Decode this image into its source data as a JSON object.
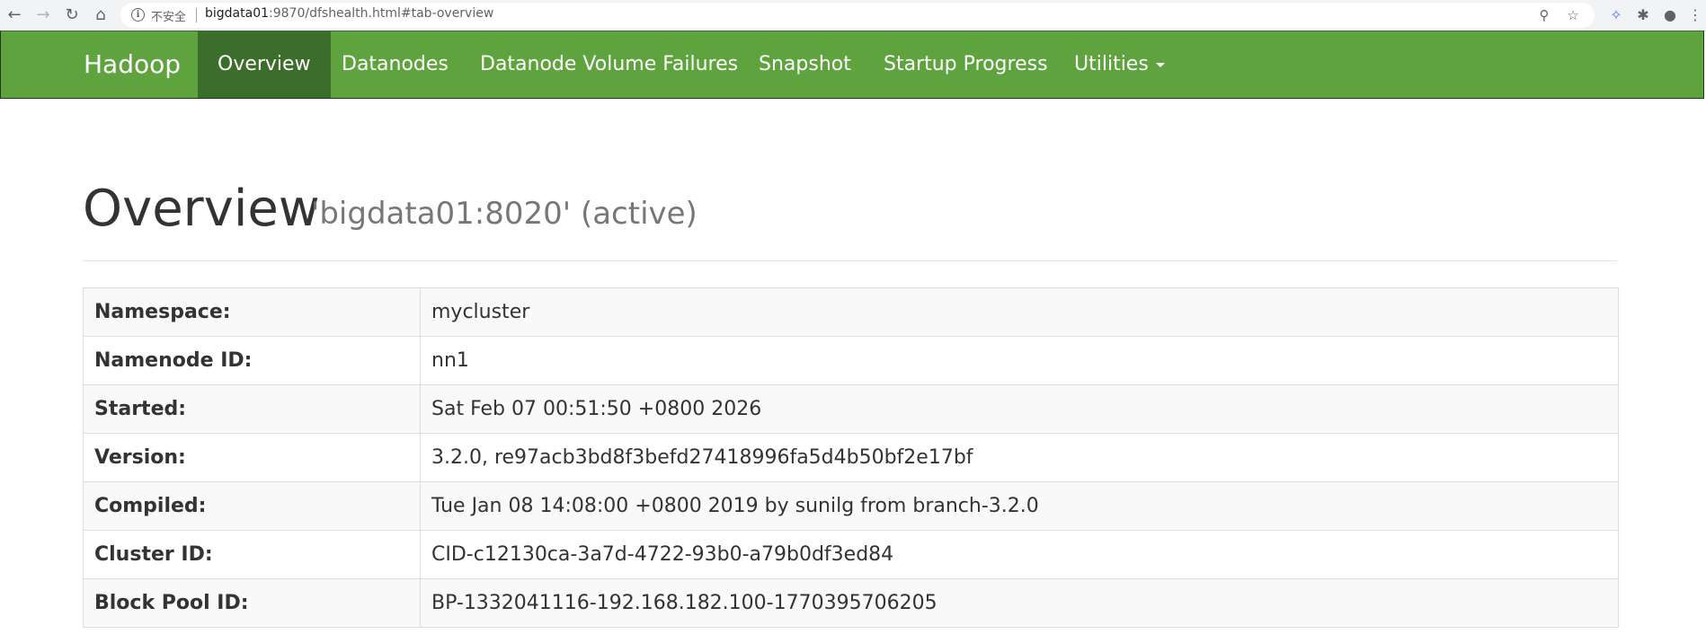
{
  "browser": {
    "security_label": "不安全",
    "url_host": "bigdata01",
    "url_rest": ":9870/dfshealth.html#tab-overview"
  },
  "navbar": {
    "brand": "Hadoop",
    "items": [
      {
        "label": "Overview",
        "active": true
      },
      {
        "label": "Datanodes",
        "active": false
      },
      {
        "label": "Datanode Volume Failures",
        "active": false
      },
      {
        "label": "Snapshot",
        "active": false
      },
      {
        "label": "Startup Progress",
        "active": false
      },
      {
        "label": "Utilities",
        "active": false,
        "dropdown": true
      }
    ],
    "colors": {
      "background": "#5fa33e",
      "active_background": "#3b6e2a"
    }
  },
  "header": {
    "title": "Overview",
    "subtitle": "'bigdata01:8020' (active)"
  },
  "overview_table": [
    {
      "key": "Namespace:",
      "value": "mycluster"
    },
    {
      "key": "Namenode ID:",
      "value": "nn1"
    },
    {
      "key": "Started:",
      "value": "Sat Feb 07 00:51:50 +0800 2026"
    },
    {
      "key": "Version:",
      "value": "3.2.0, re97acb3bd8f3befd27418996fa5d4b50bf2e17bf"
    },
    {
      "key": "Compiled:",
      "value": "Tue Jan 08 14:08:00 +0800 2019 by sunilg from branch-3.2.0"
    },
    {
      "key": "Cluster ID:",
      "value": "CID-c12130ca-3a7d-4722-93b0-a79b0df3ed84"
    },
    {
      "key": "Block Pool ID:",
      "value": "BP-1332041116-192.168.182.100-1770395706205"
    }
  ]
}
